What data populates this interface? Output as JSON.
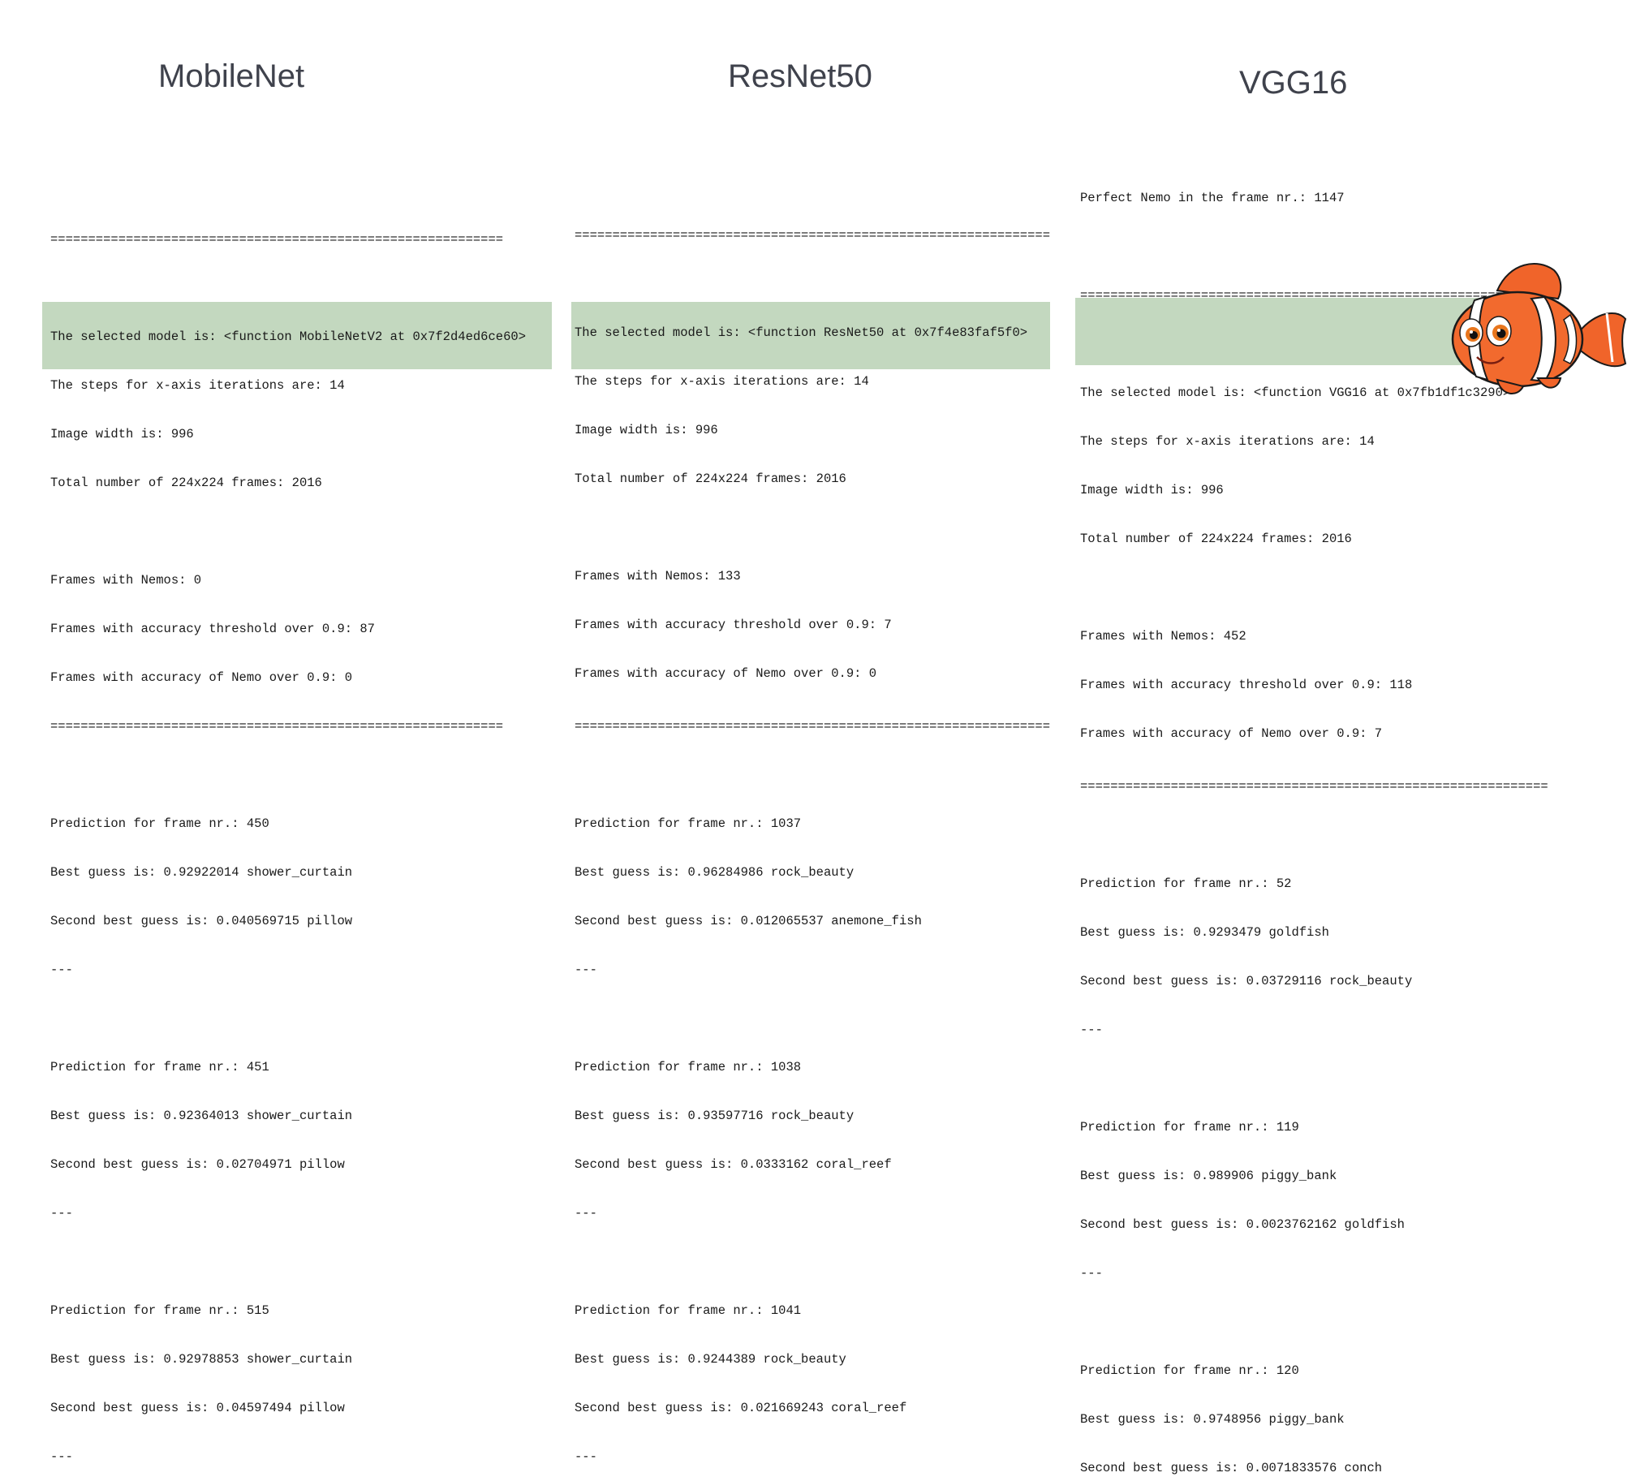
{
  "colors": {
    "highlight": "#c3d8bf",
    "title": "#3f424c",
    "text": "#1a1a1a"
  },
  "columns": [
    {
      "title": "MobileNet",
      "pre_lines": [],
      "separator": "============================================================",
      "model_lines": [
        "The selected model is: <function MobileNetV2 at 0x7f2d4ed6ce60>",
        "The steps for x-axis iterations are: 14",
        "Image width is: 996",
        "Total number of 224x224 frames: 2016"
      ],
      "summary_lines": [
        "Frames with Nemos: 0",
        "Frames with accuracy threshold over 0.9: 87",
        "Frames with accuracy of Nemo over 0.9: 0"
      ],
      "predictions": [
        {
          "frame": "Prediction for frame nr.: 450",
          "best": "Best guess is: 0.92922014 shower_curtain",
          "second": "Second best guess is: 0.040569715 pillow",
          "end": "---"
        },
        {
          "frame": "Prediction for frame nr.: 451",
          "best": "Best guess is: 0.92364013 shower_curtain",
          "second": "Second best guess is: 0.02704971 pillow",
          "end": "---"
        },
        {
          "frame": "Prediction for frame nr.: 515",
          "best": "Best guess is: 0.92978853 shower_curtain",
          "second": "Second best guess is: 0.04597494 pillow",
          "end": "---"
        }
      ]
    },
    {
      "title": "ResNet50",
      "pre_lines": [],
      "separator": "===============================================================",
      "model_lines": [
        "The selected model is: <function ResNet50 at 0x7f4e83faf5f0>",
        "The steps for x-axis iterations are: 14",
        "Image width is: 996",
        "Total number of 224x224 frames: 2016"
      ],
      "summary_lines": [
        "Frames with Nemos: 133",
        "Frames with accuracy threshold over 0.9: 7",
        "Frames with accuracy of Nemo over 0.9: 0"
      ],
      "predictions": [
        {
          "frame": "Prediction for frame nr.: 1037",
          "best": "Best guess is: 0.96284986 rock_beauty",
          "second": "Second best guess is: 0.012065537 anemone_fish",
          "end": "---"
        },
        {
          "frame": "Prediction for frame nr.: 1038",
          "best": "Best guess is: 0.93597716 rock_beauty",
          "second": "Second best guess is: 0.0333162 coral_reef",
          "end": "---"
        },
        {
          "frame": "Prediction for frame nr.: 1041",
          "best": "Best guess is: 0.9244389 rock_beauty",
          "second": "Second best guess is: 0.021669243 coral_reef",
          "end": "---"
        }
      ]
    },
    {
      "title": "VGG16",
      "pre_lines": [
        "Perfect Nemo in the frame nr.: 1147"
      ],
      "separator": "==============================================================",
      "model_lines": [
        "The selected model is: <function VGG16 at 0x7fb1df1c3290>",
        "The steps for x-axis iterations are: 14",
        "Image width is: 996",
        "Total number of 224x224 frames: 2016"
      ],
      "summary_lines": [
        "Frames with Nemos: 452",
        "Frames with accuracy threshold over 0.9: 118",
        "Frames with accuracy of Nemo over 0.9: 7"
      ],
      "predictions": [
        {
          "frame": "Prediction for frame nr.: 52",
          "best": "Best guess is: 0.9293479 goldfish",
          "second": "Second best guess is: 0.03729116 rock_beauty",
          "end": "---"
        },
        {
          "frame": "Prediction for frame nr.: 119",
          "best": "Best guess is: 0.989906 piggy_bank",
          "second": "Second best guess is: 0.0023762162 goldfish",
          "end": "---"
        },
        {
          "frame": "Prediction for frame nr.: 120",
          "best": "Best guess is: 0.9748956 piggy_bank",
          "second": "Second best guess is: 0.0071833576 conch",
          "end": "---"
        }
      ]
    }
  ],
  "illustration": {
    "icon": "clownfish-icon"
  }
}
